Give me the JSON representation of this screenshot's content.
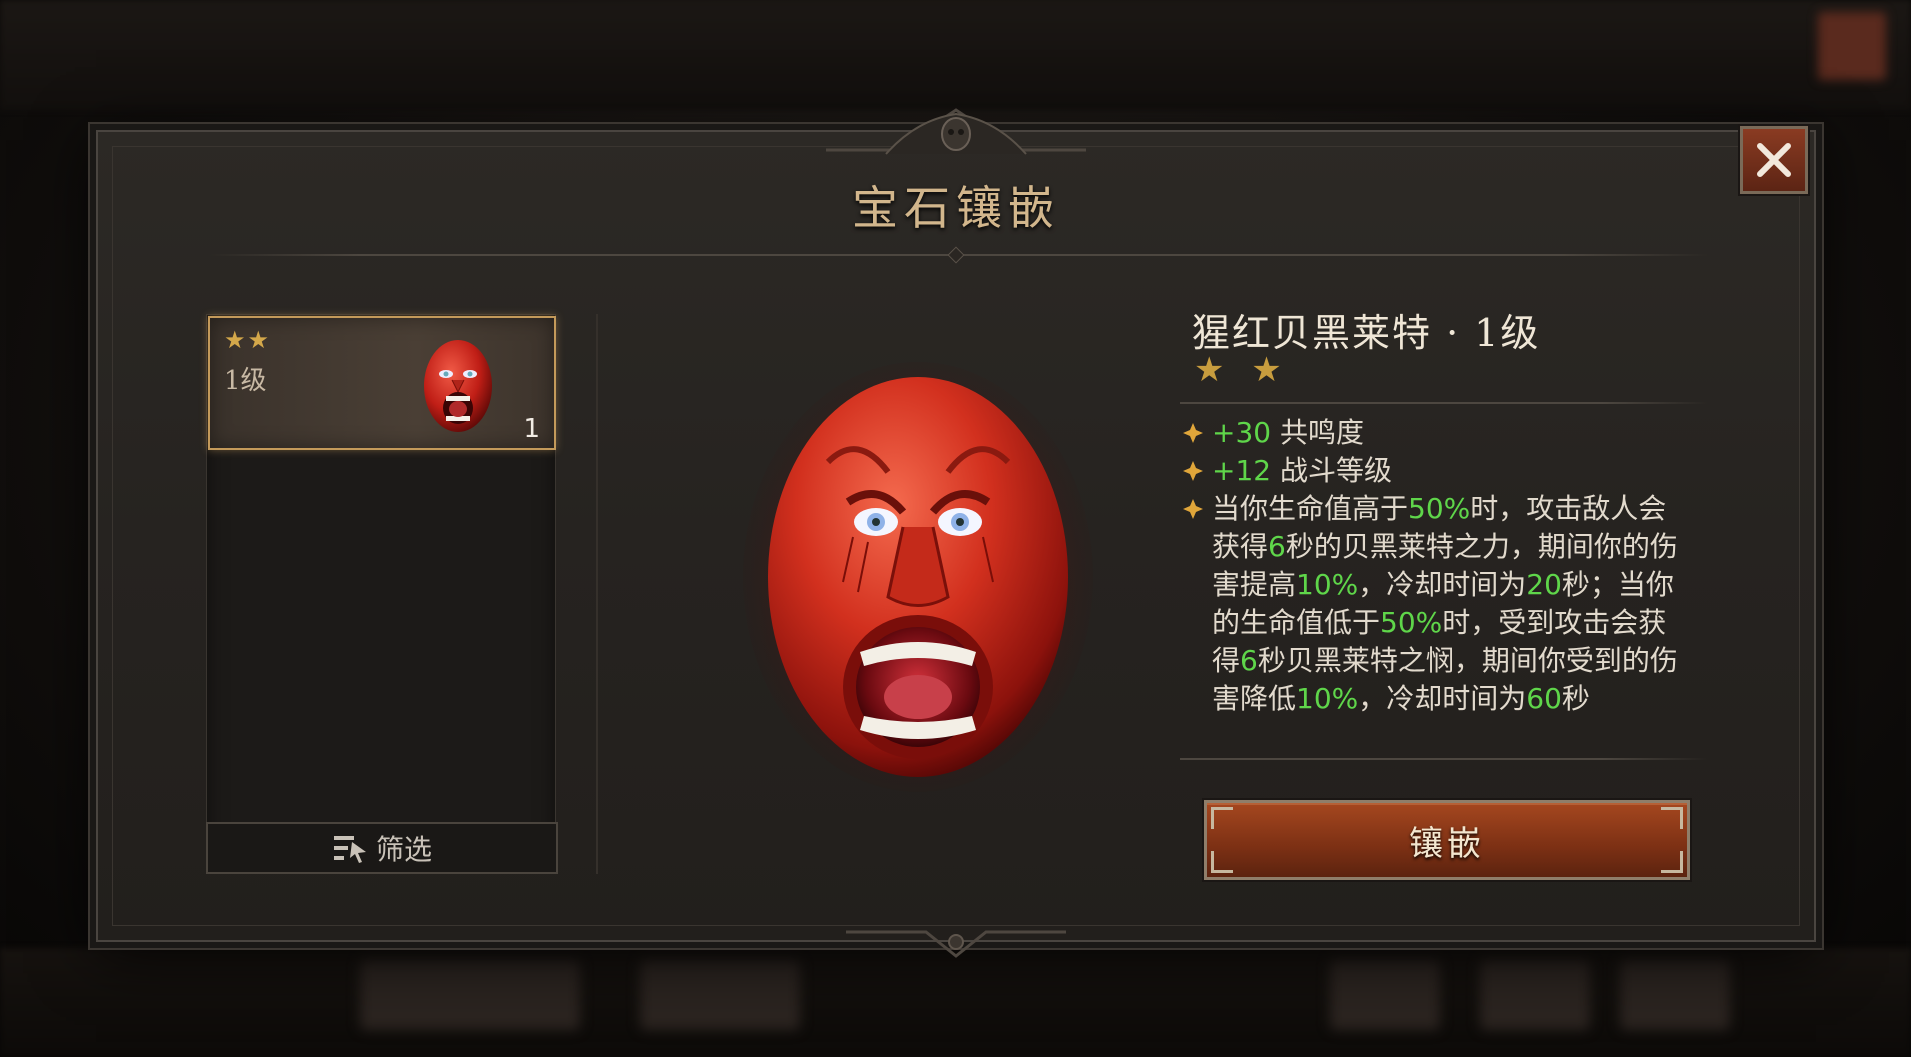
{
  "dialog": {
    "title": "宝石镶嵌",
    "close_icon": "close-icon"
  },
  "gem_list": {
    "items": [
      {
        "stars": "★★",
        "level": "1级",
        "count": "1",
        "selected": true
      }
    ],
    "filter_label": "筛选",
    "filter_icon": "filter-list-icon"
  },
  "gem_detail": {
    "name": "猩红贝黑莱特 · 1级",
    "stars": "★ ★",
    "attributes": [
      {
        "value": "+30",
        "label": " 共鸣度"
      },
      {
        "value": "+12",
        "label": " 战斗等级"
      }
    ],
    "effect": {
      "p1": "当你生命值高于",
      "v1": "50%",
      "p2": "时，攻击敌人会获得",
      "v2": "6",
      "p3": "秒的贝黑莱特之力，期间你的伤害提高",
      "v3": "10%",
      "p4": "，冷却时间为",
      "v4": "20",
      "p5": "秒；当你的生命值低于",
      "v5": "50%",
      "p6": "时，受到攻击会获得",
      "v6": "6",
      "p7": "秒贝黑莱特之悯，期间你受到的伤害降低",
      "v7": "10%",
      "p8": "，冷却时间为",
      "v8": "60",
      "p9": "秒"
    },
    "inlay_label": "镶嵌"
  },
  "colors": {
    "accent_gold": "#c49a5a",
    "value_green": "#5fd64a",
    "button_red": "#7c3014"
  }
}
